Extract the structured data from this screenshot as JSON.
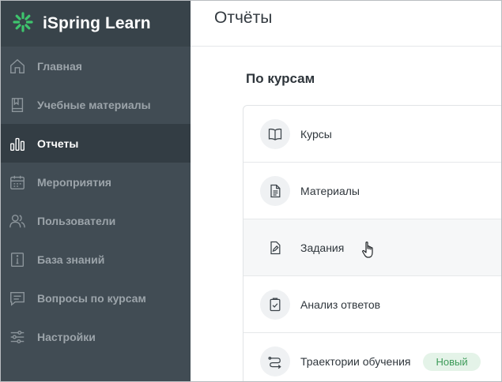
{
  "app": {
    "name": "iSpring Learn",
    "brand_color": "#3ec46d"
  },
  "sidebar": {
    "items": [
      {
        "label": "Главная",
        "icon": "home-icon",
        "active": false
      },
      {
        "label": "Учебные материалы",
        "icon": "book-icon",
        "active": false
      },
      {
        "label": "Отчеты",
        "icon": "bar-chart-icon",
        "active": true
      },
      {
        "label": "Мероприятия",
        "icon": "calendar-icon",
        "active": false
      },
      {
        "label": "Пользователи",
        "icon": "users-icon",
        "active": false
      },
      {
        "label": "База знаний",
        "icon": "info-book-icon",
        "active": false
      },
      {
        "label": "Вопросы по курсам",
        "icon": "chat-icon",
        "active": false
      },
      {
        "label": "Настройки",
        "icon": "sliders-icon",
        "active": false
      }
    ]
  },
  "header": {
    "title": "Отчёты"
  },
  "main": {
    "section_title": "По курсам",
    "reports": [
      {
        "label": "Курсы",
        "icon": "open-book-icon"
      },
      {
        "label": "Материалы",
        "icon": "document-icon"
      },
      {
        "label": "Задания",
        "icon": "edit-document-icon"
      },
      {
        "label": "Анализ ответов",
        "icon": "checklist-icon"
      },
      {
        "label": "Траектории обучения",
        "icon": "route-icon",
        "badge": "Новый"
      }
    ]
  }
}
